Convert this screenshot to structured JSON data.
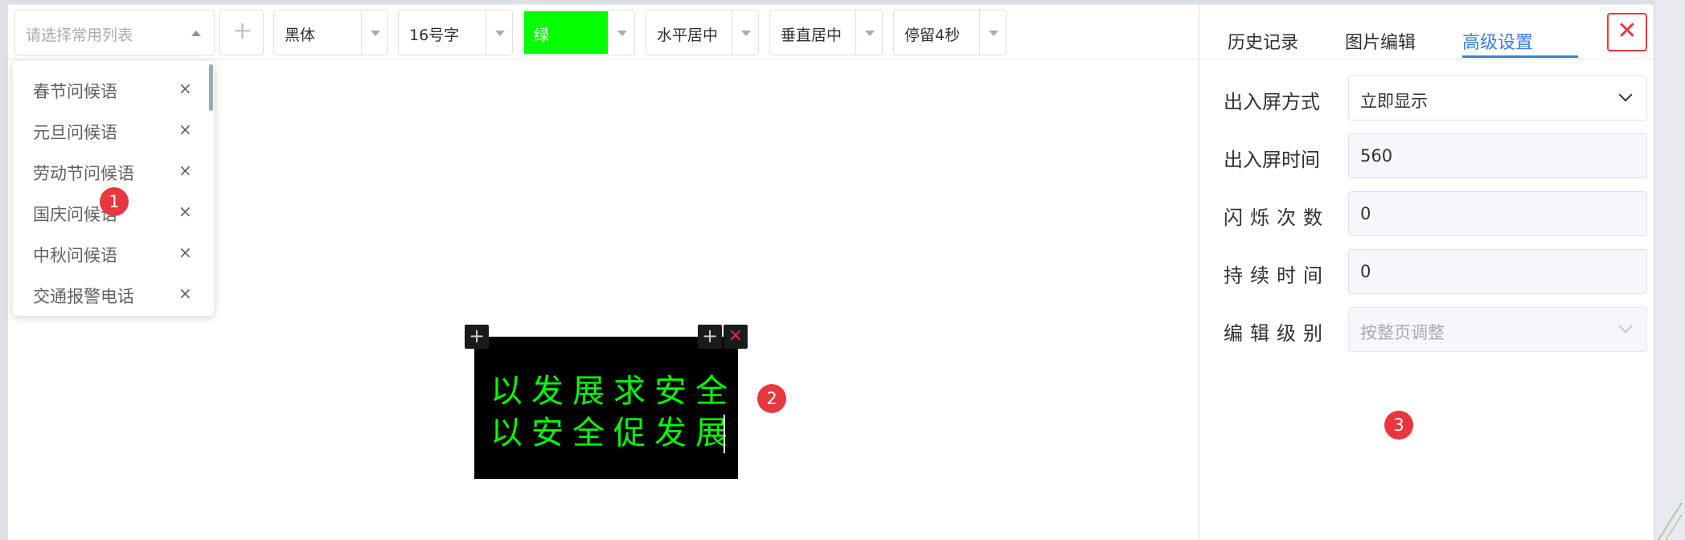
{
  "toolbar": {
    "list_placeholder": "请选择常用列表",
    "add_label": "+",
    "font": "黑体",
    "font_size": "16号字",
    "color_label": "绿",
    "color_value": "#00ff00",
    "h_align": "水平居中",
    "v_align": "垂直居中",
    "stay": "停留4秒"
  },
  "dropdown": {
    "items": [
      {
        "label": "春节问候语",
        "remove": "×"
      },
      {
        "label": "元旦问候语",
        "remove": "×"
      },
      {
        "label": "劳动节问候语",
        "remove": "×"
      },
      {
        "label": "国庆问候语",
        "remove": "×"
      },
      {
        "label": "中秋问候语",
        "remove": "×"
      },
      {
        "label": "交通报警电话",
        "remove": "×"
      }
    ]
  },
  "led": {
    "line1": "以发展求安全",
    "line2": "以安全促发展",
    "text_color": "#00ff00",
    "background": "#000000",
    "add_icon": "+",
    "close_icon": "×"
  },
  "badges": {
    "b1": "1",
    "b2": "2",
    "b3": "3"
  },
  "panel": {
    "tabs": [
      {
        "label": "历史记录"
      },
      {
        "label": "图片编辑"
      },
      {
        "label": "高级设置",
        "active": true
      }
    ],
    "close_icon": "✕",
    "fields": [
      {
        "label": "出入屏方式",
        "value": "立即显示",
        "type": "select"
      },
      {
        "label": "出入屏时间",
        "value": "560",
        "type": "input"
      },
      {
        "label": "闪烁次数",
        "value": "0",
        "type": "input"
      },
      {
        "label": "持续时间",
        "value": "0",
        "type": "input"
      },
      {
        "label": "编辑级别",
        "value": "按整页调整",
        "type": "select-disabled"
      }
    ]
  },
  "colors": {
    "accent": "#3a7de0",
    "danger": "#e8383d"
  }
}
